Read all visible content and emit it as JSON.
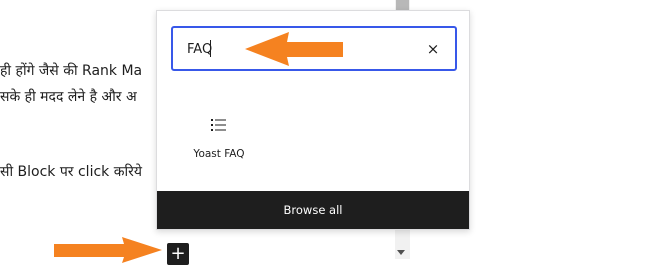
{
  "editor": {
    "line1": "ही होंगे जैसे की Rank Ma",
    "line2": "सके ही मदद लेने है और अ",
    "line3": "सी Block पर click करिये"
  },
  "inserter": {
    "search_value": "FAQ",
    "clear_icon": "×",
    "results": [
      {
        "label": "Yoast FAQ",
        "icon": "list-icon"
      }
    ],
    "browse_all_label": "Browse all"
  },
  "plus_button": {
    "label": "+"
  },
  "colors": {
    "accent": "#3858e9",
    "arrow": "#f58220",
    "dark": "#1e1e1e"
  }
}
